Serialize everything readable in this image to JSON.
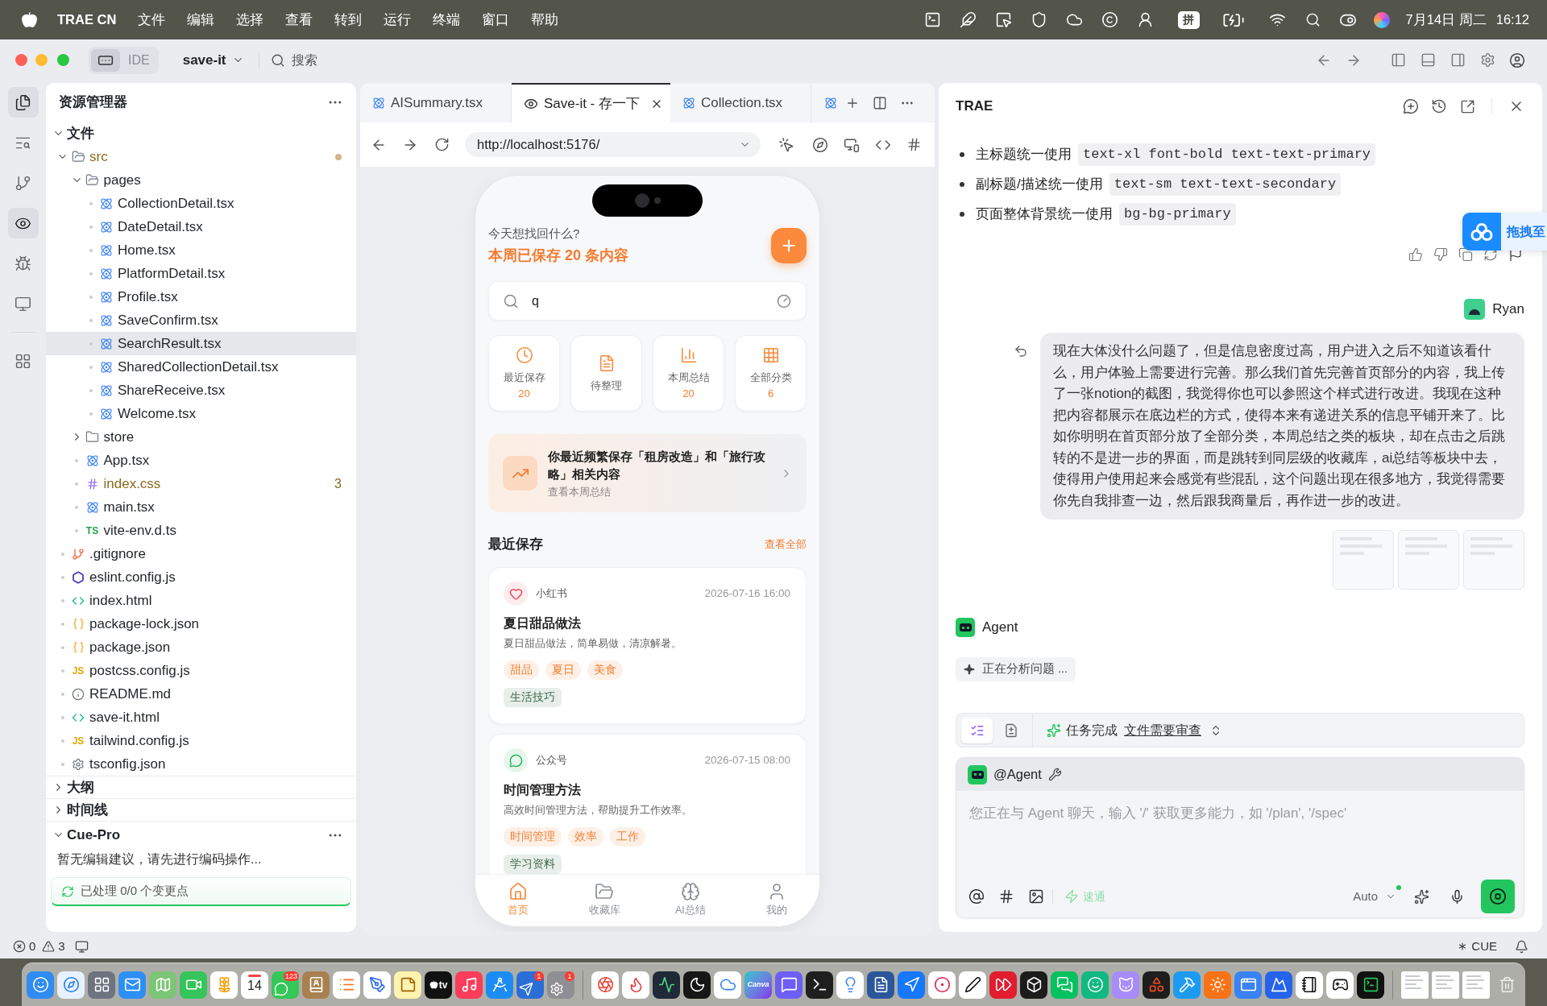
{
  "menu_bar": {
    "app_name": "TRAE CN",
    "menus": [
      "文件",
      "编辑",
      "选择",
      "查看",
      "转到",
      "运行",
      "终端",
      "窗口",
      "帮助"
    ],
    "input_method": "拼",
    "date": "7月14日 周二",
    "time": "16:12"
  },
  "toolbar": {
    "mode_switch": [
      {
        "kind": "icon",
        "selected": true
      },
      {
        "kind": "text",
        "label": "IDE",
        "selected": false
      }
    ],
    "project": "save-it",
    "search_label": "搜索"
  },
  "activity_bar": [
    {
      "kind": "files",
      "selected": true
    },
    {
      "kind": "search",
      "selected": false
    },
    {
      "kind": "source_control",
      "selected": false
    },
    {
      "kind": "preview",
      "selected": true
    },
    {
      "kind": "debug",
      "selected": false
    },
    {
      "kind": "remote",
      "selected": false
    },
    {
      "kind": "extensions",
      "selected": false
    }
  ],
  "explorer": {
    "title": "资源管理器",
    "sections": [
      {
        "kind": "tree",
        "title": "文件",
        "expanded": true,
        "tree": [
          {
            "label": "src",
            "kind": "folder",
            "expanded": true,
            "selected": false,
            "modified": true,
            "children": [
              {
                "label": "pages",
                "kind": "folder",
                "expanded": true,
                "selected": false,
                "modified": false,
                "children": [
                  {
                    "label": "CollectionDetail.tsx",
                    "kind": "react",
                    "selected": false,
                    "modified": false
                  },
                  {
                    "label": "DateDetail.tsx",
                    "kind": "react",
                    "selected": false,
                    "modified": false
                  },
                  {
                    "label": "Home.tsx",
                    "kind": "react",
                    "selected": false,
                    "modified": false
                  },
                  {
                    "label": "PlatformDetail.tsx",
                    "kind": "react",
                    "selected": false,
                    "modified": false
                  },
                  {
                    "label": "Profile.tsx",
                    "kind": "react",
                    "selected": false,
                    "modified": false
                  },
                  {
                    "label": "SaveConfirm.tsx",
                    "kind": "react",
                    "selected": false,
                    "modified": false
                  },
                  {
                    "label": "SearchResult.tsx",
                    "kind": "react",
                    "selected": true,
                    "modified": false
                  },
                  {
                    "label": "SharedCollectionDetail.tsx",
                    "kind": "react",
                    "selected": false,
                    "modified": false
                  },
                  {
                    "label": "ShareReceive.tsx",
                    "kind": "react",
                    "selected": false,
                    "modified": false
                  },
                  {
                    "label": "Welcome.tsx",
                    "kind": "react",
                    "selected": false,
                    "modified": false
                  }
                ]
              },
              {
                "label": "store",
                "kind": "folder",
                "expanded": false,
                "selected": false,
                "modified": false
              },
              {
                "label": "App.tsx",
                "kind": "react",
                "selected": false,
                "modified": false
              },
              {
                "label": "index.css",
                "kind": "css",
                "selected": false,
                "modified": true,
                "problems": "3"
              },
              {
                "label": "main.tsx",
                "kind": "react",
                "selected": false,
                "modified": false
              },
              {
                "label": "vite-env.d.ts",
                "kind": "ts",
                "icon_text": "TS",
                "selected": false,
                "modified": false
              }
            ]
          },
          {
            "label": ".gitignore",
            "kind": "git",
            "selected": false,
            "modified": false
          },
          {
            "label": "eslint.config.js",
            "kind": "eslint",
            "selected": false,
            "modified": false
          },
          {
            "label": "index.html",
            "kind": "html",
            "selected": false,
            "modified": false
          },
          {
            "label": "package-lock.json",
            "kind": "json",
            "selected": false,
            "modified": false
          },
          {
            "label": "package.json",
            "kind": "json",
            "selected": false,
            "modified": false
          },
          {
            "label": "postcss.config.js",
            "kind": "js",
            "icon_text": "JS",
            "selected": false,
            "modified": false
          },
          {
            "label": "README.md",
            "kind": "info",
            "selected": false,
            "modified": false
          },
          {
            "label": "save-it.html",
            "kind": "html",
            "selected": false,
            "modified": false
          },
          {
            "label": "tailwind.config.js",
            "kind": "js",
            "icon_text": "JS",
            "selected": false,
            "modified": false
          },
          {
            "label": "tsconfig.json",
            "kind": "config",
            "selected": false,
            "modified": false
          }
        ]
      },
      {
        "kind": "list",
        "title": "大纲",
        "expanded": false
      },
      {
        "kind": "list",
        "title": "时间线",
        "expanded": false
      },
      {
        "kind": "suggestions",
        "title": "Cue-Pro",
        "expanded": true,
        "message": "暂无编辑建议，请先进行编码操作...",
        "progress": "已处理 0/0 个变更点"
      }
    ]
  },
  "editor": {
    "tabs": [
      {
        "label": "AISummary.tsx",
        "kind": "react",
        "selected": false
      },
      {
        "label": "Save-it - 存一下",
        "kind": "preview",
        "selected": true
      },
      {
        "label": "Collection.tsx",
        "kind": "react",
        "selected": false
      }
    ],
    "url": "http://localhost:5176/"
  },
  "app": {
    "greeting": "今天想找回什么?",
    "weekly_summary": "本周已保存 20 条内容",
    "search": {
      "value": "q"
    },
    "quick_actions": [
      {
        "kind": "clock",
        "label": "最近保存",
        "count": "20"
      },
      {
        "kind": "document",
        "label": "待整理"
      },
      {
        "kind": "chart",
        "label": "本周总结",
        "count": "20"
      },
      {
        "kind": "grid",
        "label": "全部分类",
        "count": "6"
      }
    ],
    "insight": {
      "title": "你最近频繁保存「租房改造」和「旅行攻略」相关内容",
      "subtitle": "查看本周总结"
    },
    "recent": {
      "title": "最近保存",
      "see_all": "查看全部",
      "items": [
        {
          "kind": "heart",
          "source": "小红书",
          "date": "2026-07-16 16:00",
          "title": "夏日甜品做法",
          "description": "夏日甜品做法，简单易做，清凉解暑。",
          "tags": [
            "甜品",
            "夏日",
            "美食"
          ],
          "category": "生活技巧"
        },
        {
          "kind": "chat",
          "source": "公众号",
          "date": "2026-07-15 08:00",
          "title": "时间管理方法",
          "description": "高效时间管理方法，帮助提升工作效率。",
          "tags": [
            "时间管理",
            "效率",
            "工作"
          ],
          "category": "学习资料"
        }
      ]
    },
    "tab_bar": [
      {
        "kind": "home",
        "label": "首页",
        "selected": true
      },
      {
        "kind": "folder",
        "label": "收藏库",
        "selected": false
      },
      {
        "kind": "brain",
        "label": "AI总结",
        "selected": false
      },
      {
        "kind": "user",
        "label": "我的",
        "selected": false
      }
    ]
  },
  "assistant": {
    "title": "TRAE",
    "bullets": [
      {
        "text": "主标题统一使用",
        "code": "text-xl font-bold text-text-primary"
      },
      {
        "text": "副标题/描述统一使用",
        "code": "text-sm text-text-secondary"
      },
      {
        "text": "页面整体背景统一使用",
        "code": "bg-bg-primary"
      }
    ],
    "user_message": {
      "author": "Ryan",
      "text": "现在大体没什么问题了，但是信息密度过高，用户进入之后不知道该看什么，用户体验上需要进行完善。那么我们首先完善首页部分的内容，我上传了一张notion的截图，我觉得你也可以参照这个样式进行改进。我现在这种把内容都展示在底边栏的方式，使得本来有递进关系的信息平铺开来了。比如你明明在首页部分放了全部分类，本周总结之类的板块，却在点击之后跳转的不是进一步的界面，而是跳转到同层级的收藏库，ai总结等板块中去，使得用户使用起来会感觉有些混乱，这个问题出现在很多地方，我觉得需要你先自我排查一边，然后跟我商量后，再作进一步的改进。"
    },
    "attachments": [
      {
        "kind": "image"
      },
      {
        "kind": "image"
      },
      {
        "kind": "image"
      }
    ],
    "agent": {
      "name": "Agent",
      "status": "正在分析问题 ..."
    },
    "task_bar": {
      "view_tabs": [
        {
          "kind": "checklist",
          "selected": true
        },
        {
          "kind": "diff",
          "selected": false
        }
      ],
      "status": "任务完成",
      "link": "文件需要审查"
    },
    "composer": {
      "mention": "@Agent",
      "placeholder": "您正在与 Agent 聊天，输入 '/' 获取更多能力，如 '/plan', '/spec'",
      "fast_mode": {
        "label": "速通",
        "on": false
      },
      "model": "Auto"
    }
  },
  "drag_widget": {
    "label": "拖拽至"
  },
  "status_bar": {
    "errors": "0",
    "warnings": "3",
    "cue": "CUE"
  },
  "dock": {
    "calendar_day": "14",
    "tv_label": "tv",
    "canva_label": "Canva",
    "badges": [
      "123",
      "1",
      "1"
    ]
  }
}
